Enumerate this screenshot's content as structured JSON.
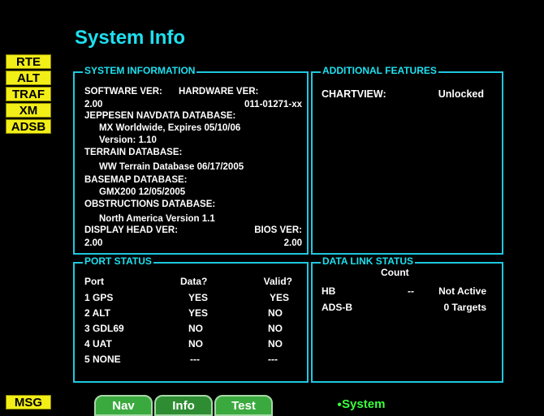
{
  "title": "System Info",
  "softkeys": [
    "RTE",
    "ALT",
    "TRAF",
    "XM",
    "ADSB"
  ],
  "msg_key": "MSG",
  "system_information": {
    "legend": "SYSTEM INFORMATION",
    "software_ver_label": "SOFTWARE VER:",
    "hardware_ver_label": "HARDWARE VER:",
    "software_ver": "2.00",
    "hardware_ver": "011-01271-xx",
    "jeppesen_label": "JEPPESEN NAVDATA DATABASE:",
    "jeppesen_value": "MX Worldwide, Expires 05/10/06",
    "jeppesen_version": "Version: 1.10",
    "terrain_label": "TERRAIN DATABASE:",
    "terrain_value": "WW Terrain Database 06/17/2005",
    "basemap_label": "BASEMAP DATABASE:",
    "basemap_value": "GMX200 12/05/2005",
    "obstructions_label": "OBSTRUCTIONS DATABASE:",
    "obstructions_value": "North America Version 1.1",
    "display_head_label": "DISPLAY HEAD VER:",
    "bios_label": "BIOS VER:",
    "display_head_ver": "2.00",
    "bios_ver": "2.00"
  },
  "additional_features": {
    "legend": "ADDITIONAL FEATURES",
    "chartview_label": "CHARTVIEW:",
    "chartview_value": "Unlocked"
  },
  "port_status": {
    "legend": "PORT STATUS",
    "headers": [
      "Port",
      "Data?",
      "Valid?"
    ],
    "rows": [
      [
        "1 GPS",
        "YES",
        "YES"
      ],
      [
        "2 ALT",
        "YES",
        "NO"
      ],
      [
        "3 GDL69",
        "NO",
        "NO"
      ],
      [
        "4 UAT",
        "NO",
        "NO"
      ],
      [
        "5 NONE",
        "---",
        "---"
      ]
    ]
  },
  "data_link_status": {
    "legend": "DATA LINK STATUS",
    "count_header": "Count",
    "rows": [
      [
        "HB",
        "--",
        "Not Active"
      ],
      [
        "ADS-B",
        "",
        "0 Targets"
      ]
    ]
  },
  "tabs": [
    "Nav",
    "Info",
    "Test"
  ],
  "active_tab": "Info",
  "page_indicator": "System",
  "colors": {
    "accent": "#1ee0f0",
    "softkey": "#f2ee18",
    "tab": "#3aaa3e",
    "indicator": "#3cff3c"
  }
}
